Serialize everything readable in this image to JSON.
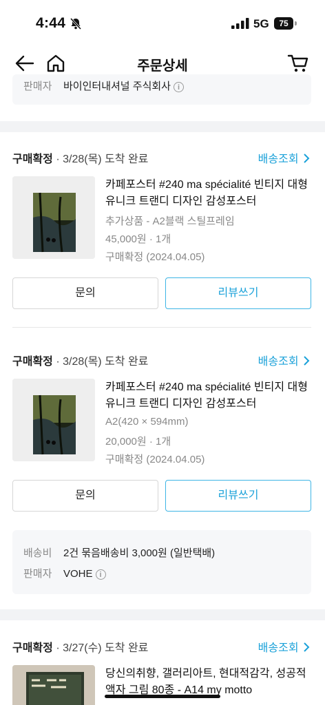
{
  "status_bar": {
    "time": "4:44",
    "network": "5G",
    "battery": "75"
  },
  "header": {
    "title": "주문상세"
  },
  "top_seller": {
    "label": "판매자",
    "value": "바이인터내셔널 주식회사"
  },
  "orders": [
    {
      "status": "구매확정",
      "arrival": " · 3/28(목) 도착 완료",
      "track_label": "배송조회",
      "name": "카페포스터 #240 ma spécialité 빈티지 대형 유니크 트랜디 디자인 감성포스터",
      "option": "추가상품 - A2블랙 스틸프레임",
      "price_qty": "45,000원 · 1개",
      "confirm": "구매확정 (2024.04.05)",
      "inquiry_label": "문의",
      "review_label": "리뷰쓰기"
    },
    {
      "status": "구매확정",
      "arrival": " · 3/28(목) 도착 완료",
      "track_label": "배송조회",
      "name": "카페포스터 #240 ma spécialité 빈티지 대형 유니크 트랜디 디자인 감성포스터",
      "option": "A2(420 × 594mm)",
      "price_qty": "20,000원 · 1개",
      "confirm": "구매확정 (2024.04.05)",
      "inquiry_label": "문의",
      "review_label": "리뷰쓰기"
    },
    {
      "status": "구매확정",
      "arrival": " · 3/27(수) 도착 완료",
      "track_label": "배송조회",
      "name": "당신의취향, 갤러리아트, 현대적감각, 성공적액자 그림 80종 - A14 my motto"
    }
  ],
  "shipping_box": {
    "fee_label": "배송비",
    "fee_value": "2건 묶음배송비 3,000원 (일반택배)",
    "seller_label": "판매자",
    "seller_value": "VOHE"
  },
  "colors": {
    "accent": "#1aa1d9",
    "review_border": "#3cb4e5",
    "section_gray": "#f6f7f9"
  }
}
